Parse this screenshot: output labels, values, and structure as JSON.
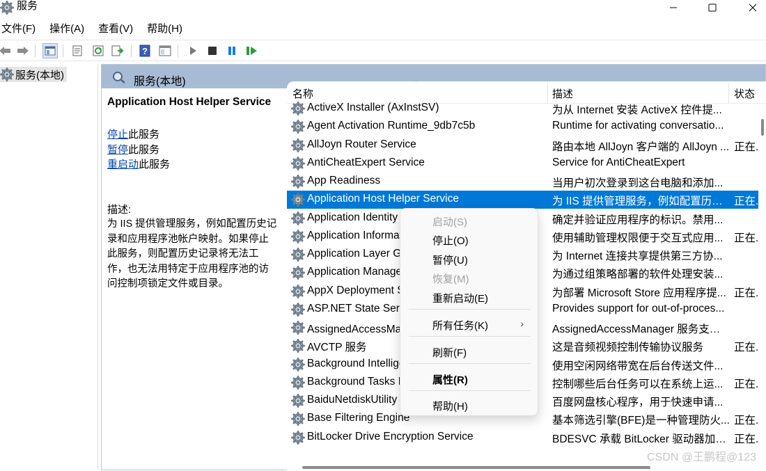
{
  "window": {
    "title": "服务"
  },
  "menu": [
    "文件(F)",
    "操作(A)",
    "查看(V)",
    "帮助(H)"
  ],
  "toolbar_icons": [
    "back-icon",
    "forward-icon",
    "show-hide-tree-icon",
    "properties-icon",
    "refresh-icon",
    "export-list-icon",
    "help-icon",
    "console-icon",
    "start-service-icon",
    "stop-service-icon",
    "pause-service-icon",
    "restart-service-icon"
  ],
  "tree": {
    "root_label": "服务(本地)"
  },
  "content_header": {
    "label": "服务(本地)"
  },
  "detail": {
    "service_title": "Application Host Helper Service",
    "stop_link": "停止",
    "stop_suffix": "此服务",
    "pause_link": "暂停",
    "pause_suffix": "此服务",
    "restart_link": "重启动",
    "restart_suffix": "此服务",
    "desc_label": "描述:",
    "description": "为 IIS 提供管理服务，例如配置历史记录和应用程序池帐户映射。如果停止此服务，则配置历史记录将无法工作，也无法用特定于应用程序池的访问控制项锁定文件或目录。"
  },
  "columns": {
    "name": "名称",
    "description": "描述",
    "status": "状态"
  },
  "services": [
    {
      "name": "ActiveX Installer (AxInstSV)",
      "description": "为从 Internet 安装 ActiveX 控件提...",
      "status": ""
    },
    {
      "name": "Agent Activation Runtime_9db7c5b",
      "description": "Runtime for activating conversatio...",
      "status": ""
    },
    {
      "name": "AllJoyn Router Service",
      "description": "路由本地 AllJoyn 客户端的 AllJoyn ...",
      "status": "正在..."
    },
    {
      "name": "AntiCheatExpert Service",
      "description": "Service for AntiCheatExpert",
      "status": ""
    },
    {
      "name": "App Readiness",
      "description": "当用户初次登录到这台电脑和添加...",
      "status": ""
    },
    {
      "name": "Application Host Helper Service",
      "description": "为 IIS 提供管理服务，例如配置历史...",
      "status": "正在..."
    },
    {
      "name": "Application Identity",
      "description": "确定并验证应用程序的标识。禁用...",
      "status": ""
    },
    {
      "name": "Application Information",
      "description": "使用辅助管理权限便于交互式应用...",
      "status": "正在..."
    },
    {
      "name": "Application Layer Gateway Service",
      "description": "为 Internet 连接共享提供第三方协...",
      "status": ""
    },
    {
      "name": "Application Management",
      "description": "为通过组策略部署的软件处理安装...",
      "status": ""
    },
    {
      "name": "AppX Deployment Service (AppXSVC)",
      "description": "为部署 Microsoft Store 应用程序提...",
      "status": "正在..."
    },
    {
      "name": "ASP.NET State Service",
      "description": "Provides support for out-of-proces...",
      "status": ""
    },
    {
      "name": "AssignedAccessManager 服务",
      "description": "AssignedAccessManager 服务支持 ...",
      "status": ""
    },
    {
      "name": "AVCTP 服务",
      "description": "这是音频视频控制传输协议服务",
      "status": "正在..."
    },
    {
      "name": "Background Intelligent Transfer Service",
      "description": "使用空闲网络带宽在后台传送文件...",
      "status": ""
    },
    {
      "name": "Background Tasks Infrastructure Service",
      "description": "控制哪些后台任务可以在系统上运...",
      "status": "正在..."
    },
    {
      "name": "BaiduNetdiskUtility",
      "description": "百度网盘核心程序，用于快速申请...",
      "status": ""
    },
    {
      "name": "Base Filtering Engine",
      "description": "基本筛选引擎(BFE)是一种管理防火...",
      "status": "正在..."
    },
    {
      "name": "BitLocker Drive Encryption Service",
      "description": "BDESVC 承载 BitLocker 驱动器加密...",
      "status": "正在..."
    }
  ],
  "selected_index": 5,
  "context_menu": {
    "start": "启动(S)",
    "stop": "停止(O)",
    "pause": "暂停(U)",
    "resume": "恢复(M)",
    "restart": "重新启动(E)",
    "all_tasks": "所有任务(K)",
    "refresh": "刷新(F)",
    "properties": "属性(R)",
    "help": "帮助(H)"
  },
  "watermark": "CSDN @王鹏程@123",
  "colors": {
    "selection": "#0078d7",
    "header": "#a7bcd4",
    "link": "#0645ad"
  }
}
